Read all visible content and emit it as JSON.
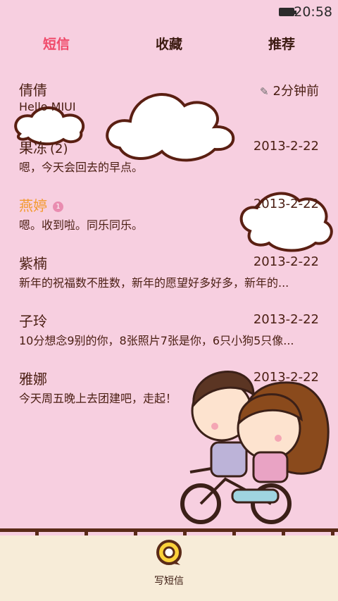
{
  "status": {
    "time": "20:58"
  },
  "tabs": [
    "短信",
    "收藏",
    "推荐"
  ],
  "messages": [
    {
      "name": "倩倩",
      "count": "",
      "badge": "",
      "time": "2分钟前",
      "preview": "Hello MIUI",
      "draft_icon": "pencil-icon"
    },
    {
      "name": "果冻",
      "count": "(2)",
      "badge": "",
      "time": "2013-2-22",
      "preview": "嗯，今天会回去的早点。"
    },
    {
      "name": "燕婷",
      "count": "",
      "badge": "1",
      "time": "2013-2-22",
      "preview": "嗯。收到啦。同乐同乐。",
      "unread": true
    },
    {
      "name": "紫楠",
      "count": "",
      "badge": "",
      "time": "2013-2-22",
      "preview": "新年的祝福数不胜数，新年的愿望好多好多，新年的..."
    },
    {
      "name": "子玲",
      "count": "",
      "badge": "",
      "time": "2013-2-22",
      "preview": "10分想念9别的你，8张照片7张是你，6只小狗5只像..."
    },
    {
      "name": "雅娜",
      "count": "",
      "badge": "",
      "time": "2013-2-22",
      "preview": "今天周五晚上去团建吧，走起！"
    }
  ],
  "compose": {
    "label": "写短信"
  },
  "colors": {
    "background": "#f7cfe0",
    "accent": "#f04a6a",
    "unread": "#f39a2e",
    "bottom_bar": "#f7ecd8"
  }
}
